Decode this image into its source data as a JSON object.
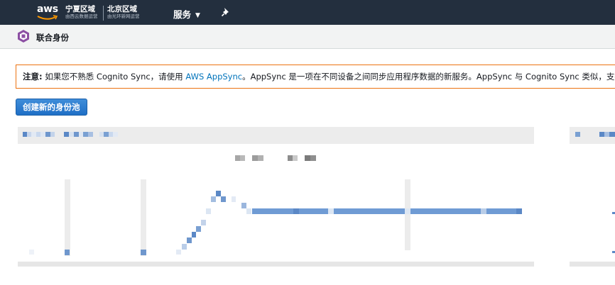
{
  "topbar": {
    "logo_text": "aws",
    "region_a": {
      "name": "宁夏区域",
      "sub": "由西云数据运营"
    },
    "region_b": {
      "name": "北京区域",
      "sub": "由光环新网运营"
    },
    "services_label": "服务",
    "icons": {
      "caret": "chevron-down-icon",
      "pin": "pin-icon"
    }
  },
  "subheader": {
    "title": "联合身份",
    "icon": "cognito-icon"
  },
  "notice": {
    "label": "注意:",
    "text_before": " 如果您不熟悉 Cognito Sync，请使用 ",
    "link_text": "AWS AppSync",
    "text_after": "。AppSync 是一项在不同设备之间同步应用程序数据的新服务。AppSync 与 Cognito Sync 类似，支持用"
  },
  "actions": {
    "create_pool_label": "创建新的身份池"
  },
  "colors": {
    "nav_bg": "#232f3e",
    "notice_border": "#ec7211",
    "link": "#0073bb",
    "button": "#2b7bd0",
    "chart_line": "#6a9bd8"
  }
}
